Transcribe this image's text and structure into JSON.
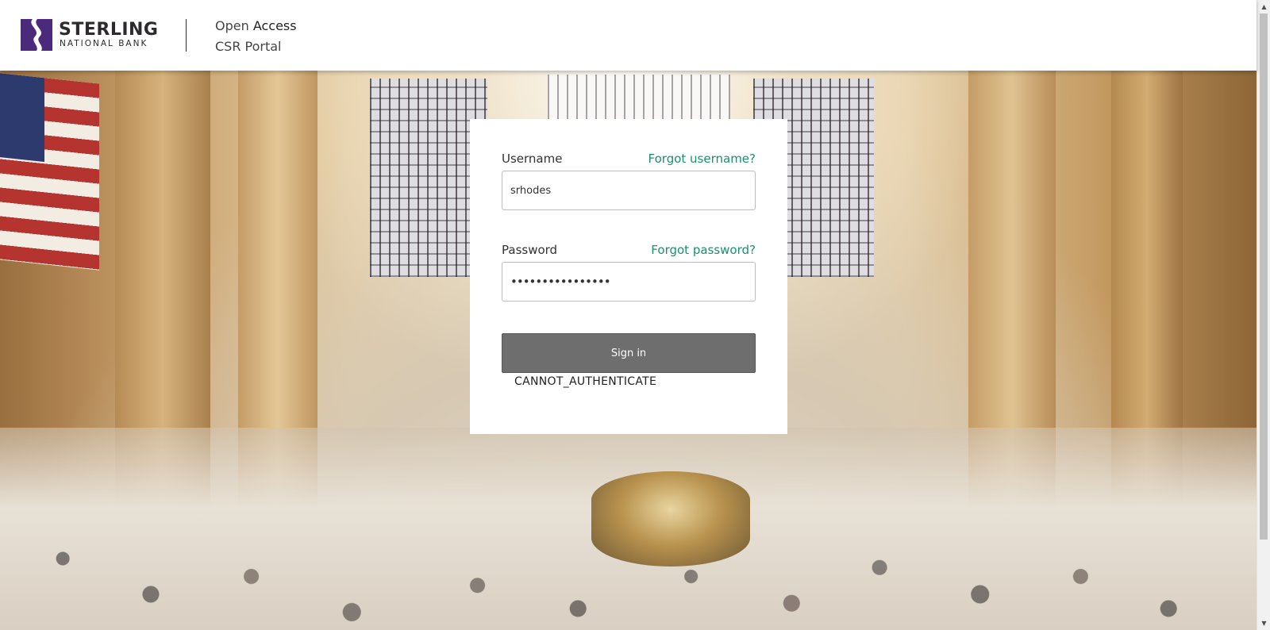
{
  "header": {
    "logo_line1": "STERLING",
    "logo_line2": "NATIONAL BANK",
    "portal_word1": "Open",
    "portal_word2": "Access",
    "portal_subtitle": "CSR Portal"
  },
  "login": {
    "username_label": "Username",
    "forgot_username": "Forgot username?",
    "username_value": "srhodes",
    "password_label": "Password",
    "forgot_password": "Forgot password?",
    "password_value": "••••••••••••••••",
    "signin_label": "Sign in",
    "error_message": "CANNOT_AUTHENTICATE"
  },
  "scrollbar": {
    "up_arrow": "▲",
    "down_arrow": "▼"
  },
  "colors": {
    "brand_purple": "#4b2a7c",
    "link_green": "#1b8f6c",
    "button_gray": "#6e6e6e"
  },
  "icons": {
    "logo_mark": "sterling-s-mark-icon"
  }
}
